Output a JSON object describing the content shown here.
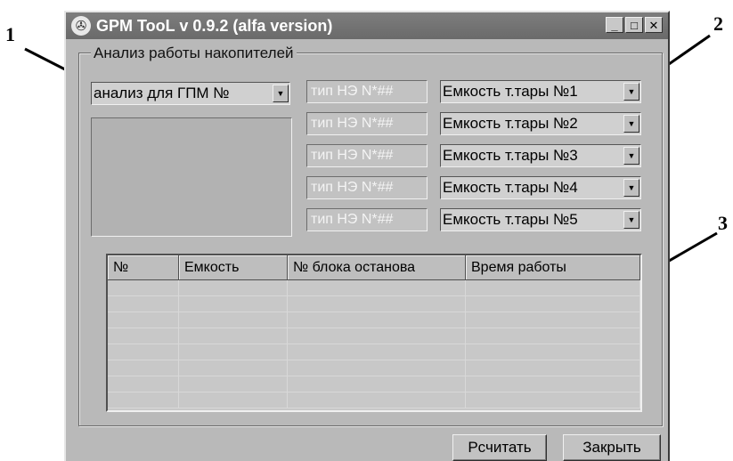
{
  "callouts": [
    "1",
    "2",
    "3"
  ],
  "window": {
    "title": "GPM TooL v 0.9.2 (alfa version)",
    "controls": {
      "minimize": "_",
      "maximize": "□",
      "close": "✕"
    },
    "icon": "gear-icon"
  },
  "group": {
    "label": "Анализ работы накопителей",
    "analysis_combo": "анализ для ГПМ №",
    "storage_types": [
      "тип НЭ N*##",
      "тип НЭ N*##",
      "тип НЭ N*##",
      "тип НЭ N*##",
      "тип НЭ N*##"
    ],
    "container_combos": [
      "Емкость т.тары №1",
      "Емкость т.тары №2",
      "Емкость т.тары №3",
      "Емкость т.тары №4",
      "Емкость т.тары №5"
    ]
  },
  "table": {
    "columns": [
      "№",
      "Емкость",
      "№ блока останова",
      "Время работы"
    ],
    "rows": []
  },
  "buttons": {
    "calculate": "Рсчитать",
    "close": "Закрыть"
  }
}
